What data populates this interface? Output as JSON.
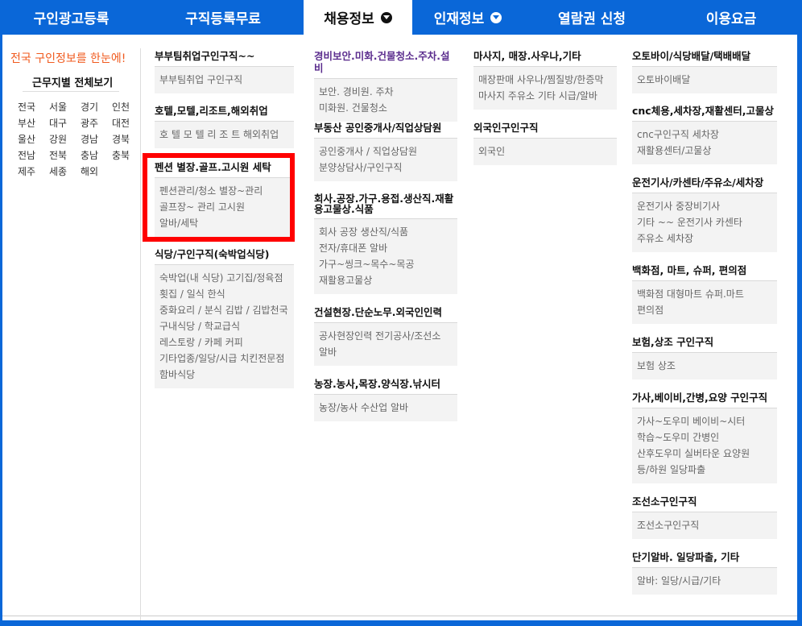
{
  "nav": {
    "items": [
      {
        "label": "구인광고등록",
        "active": false,
        "dropdown": false
      },
      {
        "label": "구직등록무료",
        "active": false,
        "dropdown": false
      },
      {
        "label": "채용정보",
        "active": true,
        "dropdown": true
      },
      {
        "label": "인재정보",
        "active": false,
        "dropdown": true
      },
      {
        "label": "열람권 신청",
        "active": false,
        "dropdown": false
      },
      {
        "label": "이용요금",
        "active": false,
        "dropdown": false
      }
    ]
  },
  "left": {
    "promo": "전국 구인정보를 한눈에!",
    "region_title": "근무지별 전체보기",
    "regions": [
      "전국",
      "서울",
      "경기",
      "인천",
      "부산",
      "대구",
      "광주",
      "대전",
      "울산",
      "강원",
      "경남",
      "경북",
      "전남",
      "전북",
      "충남",
      "충북",
      "제주",
      "세종",
      "해외"
    ]
  },
  "categories": {
    "c1": {
      "title": "부부팀취업구인구직~~",
      "lines": [
        "부부팀취업 구인구직"
      ]
    },
    "c2": {
      "title": "호텔,모텔,리조트,해외취업",
      "lines": [
        "호 텔  모 텔  리 조 트  해외취업"
      ]
    },
    "c3": {
      "title": "펜션 별장.골프.고시원 세탁",
      "lines": [
        "펜션관리/청소  별장~관리",
        "골프장~ 관리  고시원",
        "알바/세탁"
      ]
    },
    "c4": {
      "title": "식당/구인구직(숙박업식당)",
      "lines": [
        "숙박업(내 식당)  고기집/정육점",
        "횟집 / 일식  한식",
        "중화요리 / 분식  김밥 / 김밥천국",
        "구내식당 / 학교급식",
        "레스토랑 / 카페 커피",
        "기타업종/일당/시급  치킨전문점",
        "함바식당"
      ]
    },
    "c5": {
      "title": "경비보안.미화.건물청소.주차.설비",
      "lines": [
        "보안. 경비원. 주차",
        "미화원. 건물청소"
      ]
    },
    "c6": {
      "title": "부동산 공인중개사/직업상담원",
      "lines": [
        "공인중개사 / 직업상담원",
        "분양상담사/구인구직"
      ]
    },
    "c7": {
      "title": "회사.공장.가구.용접.생산직.재활용고물상.식품",
      "lines": [
        "회사  공장  생산직/식품",
        "전자/휴대폰  알바",
        "가구~씽크~목수~목공",
        "재활용고물상"
      ]
    },
    "c8": {
      "title": "건설현장.단순노무.외국인인력",
      "lines": [
        "공사현장인력  전기공사/조선소",
        "알바"
      ]
    },
    "c9": {
      "title": "농장.농사,목장.양식장.낚시터",
      "lines": [
        "농장/농사  수산업  알바"
      ]
    },
    "c10": {
      "title": "마사지, 매장.사우나,기타",
      "lines": [
        "매장판매  사우나/찜질방/한증막",
        "마사지  주유소  기타  시급/알바"
      ]
    },
    "c11": {
      "title": "외국인구인구직",
      "lines": [
        "외국인"
      ]
    },
    "c12": {
      "title": "오토바이/식당배달/택배배달",
      "lines": [
        "오토바이배달"
      ]
    },
    "c13": {
      "title": "cnc체용,세차장,재활센터,고물상",
      "lines": [
        "cnc구인구직  세차장",
        "재활용센터/고물상"
      ]
    },
    "c14": {
      "title": "운전기사/카센타/주유소/세차장",
      "lines": [
        "운전기사  중장비기사",
        "기타 ~~ 운전기사  카센타",
        "주유소  세차장"
      ]
    },
    "c15": {
      "title": "백화점, 마트, 슈퍼, 편의점",
      "lines": [
        "백화점  대형마트  슈퍼.마트",
        "편의점"
      ]
    },
    "c16": {
      "title": "보험,상조 구인구직",
      "lines": [
        "보험  상조"
      ]
    },
    "c17": {
      "title": "가사,베이비,간병,요양 구인구직",
      "lines": [
        "가사~도우미  베이비~시터",
        "학습~도우미  간병인",
        "산후도우미  실버타운  요양원",
        "등/하원  일당파출"
      ]
    },
    "c18": {
      "title": "조선소구인구직",
      "lines": [
        "조선소구인구직"
      ]
    },
    "c19": {
      "title": "단기알바. 일당파출, 기타",
      "lines": [
        "알바: 일당/시급/기타"
      ]
    }
  },
  "colors": {
    "nav_bg": "#0a67d8",
    "promo": "#f05a1e",
    "highlight": "#ff0000",
    "purple_title": "#5b2d8e"
  }
}
